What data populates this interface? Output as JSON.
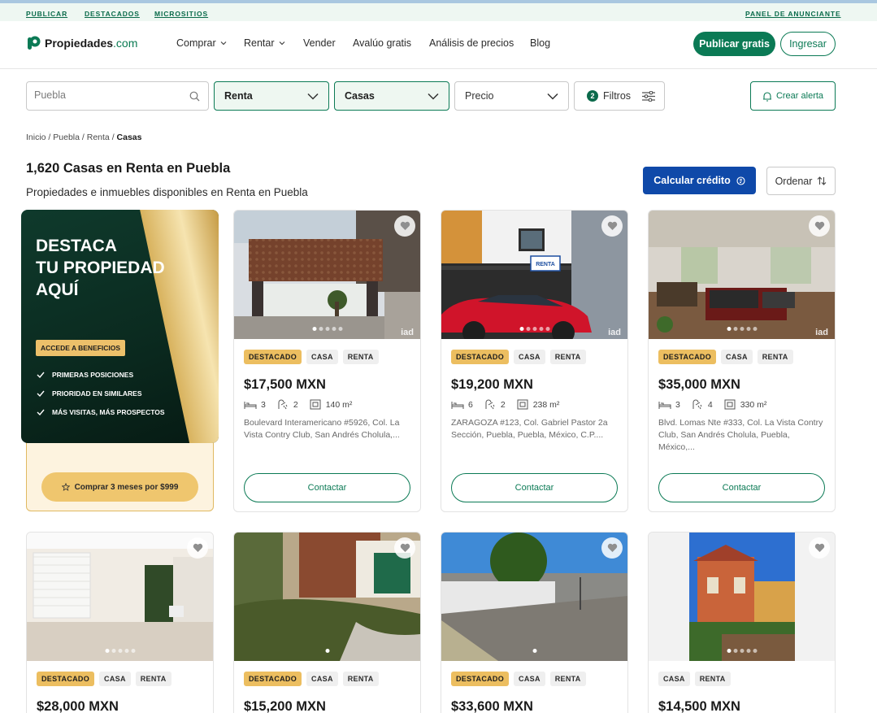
{
  "topbar": {
    "links": [
      "PUBLICAR",
      "DESTACADOS",
      "MICROSITIOS"
    ],
    "panel": "PANEL DE ANUNCIANTE"
  },
  "header": {
    "logo_main": "Propiedades",
    "logo_suffix": ".com",
    "nav": [
      "Comprar",
      "Rentar",
      "Vender",
      "Avalúo gratis",
      "Análisis de precios",
      "Blog"
    ],
    "publish_button": "Publicar gratis",
    "login_button": "Ingresar"
  },
  "filters": {
    "search_value": "",
    "search_placeholder": "Puebla",
    "operation": "Renta",
    "property_type": "Casas",
    "price": "Precio",
    "filters_count": "2",
    "filters_label": "Filtros",
    "alert_button": "Crear alerta"
  },
  "breadcrumb": {
    "parts": [
      "Inicio",
      "Puebla",
      "Renta"
    ],
    "current": "Casas",
    "separator": " / "
  },
  "results": {
    "title": "1,620 Casas en Renta en Puebla",
    "subtitle": "Propiedades e inmuebles disponibles en Renta en Puebla",
    "credit_button": "Calcular crédito",
    "sort_button": "Ordenar"
  },
  "promo": {
    "title": "DESTACA\nTU PROPIEDAD\nAQUÍ",
    "badge": "ACCEDE A BENEFICIOS",
    "benefits": [
      "PRIMERAS POSICIONES",
      "PRIORIDAD EN SIMILARES",
      "MÁS VISITAS, MÁS PROSPECTOS"
    ],
    "button": "Comprar 3 meses por $999"
  },
  "listings": [
    {
      "featured": "DESTACADO",
      "type": "CASA",
      "operation": "RENTA",
      "price": "$17,500 MXN",
      "beds": "3",
      "baths": "2",
      "area": "140 m²",
      "address": "Boulevard Interamericano #5926, Col. La Vista Contry Club, San Andrés Cholula,...",
      "contact": "Contactar"
    },
    {
      "featured": "DESTACADO",
      "type": "CASA",
      "operation": "RENTA",
      "price": "$19,200 MXN",
      "beds": "6",
      "baths": "2",
      "area": "238 m²",
      "address": "ZARAGOZA #123, Col. Gabriel Pastor 2a Sección, Puebla, Puebla, México, C.P....",
      "contact": "Contactar",
      "sign": "RENTA"
    },
    {
      "featured": "DESTACADO",
      "type": "CASA",
      "operation": "RENTA",
      "price": "$35,000 MXN",
      "beds": "3",
      "baths": "4",
      "area": "330 m²",
      "address": "Blvd. Lomas Nte #333, Col. La Vista Contry Club, San Andrés Cholula, Puebla, México,...",
      "contact": "Contactar"
    },
    {
      "featured": "DESTACADO",
      "type": "CASA",
      "operation": "RENTA",
      "price": "$28,000 MXN"
    },
    {
      "featured": "DESTACADO",
      "type": "CASA",
      "operation": "RENTA",
      "price": "$15,200 MXN"
    },
    {
      "featured": "DESTACADO",
      "type": "CASA",
      "operation": "RENTA",
      "price": "$33,600 MXN"
    },
    {
      "type": "CASA",
      "operation": "RENTA",
      "price": "$14,500 MXN"
    }
  ],
  "colors": {
    "brand_green": "#0b7a55",
    "credit_blue": "#0f49a9",
    "featured_gold": "#ecbe60"
  }
}
